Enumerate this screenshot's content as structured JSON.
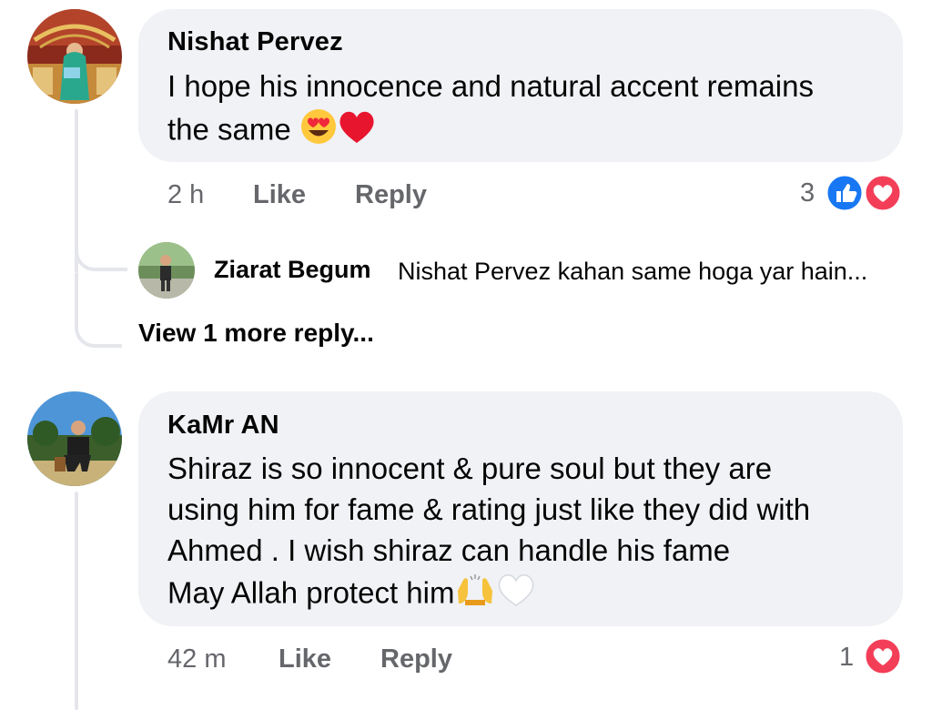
{
  "comments": [
    {
      "author": "Nishat Pervez",
      "text_line1": "I hope his innocence and natural accent remains",
      "text_line2": "the same",
      "text_emojis": [
        "heart-eyes-emoji",
        "red-heart-emoji"
      ],
      "time": "2 h",
      "like_label": "Like",
      "reply_label": "Reply",
      "reaction_count": "3",
      "reactions": [
        "like-reaction-icon",
        "love-reaction-icon"
      ],
      "replies": [
        {
          "author": "Ziarat Begum",
          "text": "Nishat Pervez kahan same hoga yar hain..."
        }
      ],
      "view_more": "View 1 more reply..."
    },
    {
      "author": "KaMr AN",
      "text_line1": "Shiraz is so innocent & pure soul but they are",
      "text_line2": "using him for fame & rating just like they did with",
      "text_line3": "Ahmed . I wish shiraz can handle his fame",
      "text_line4": "May Allah protect him",
      "text_emojis": [
        "raising-hands-emoji",
        "white-heart-emoji"
      ],
      "time": "42 m",
      "like_label": "Like",
      "reply_label": "Reply",
      "reaction_count": "1",
      "reactions": [
        "love-reaction-icon"
      ]
    }
  ],
  "colors": {
    "bubble": "#f0f2f5",
    "meta_text": "#65676b",
    "like_blue": "#1877f2",
    "love_red": "#f33e58",
    "thread_line": "#e4e6eb"
  }
}
